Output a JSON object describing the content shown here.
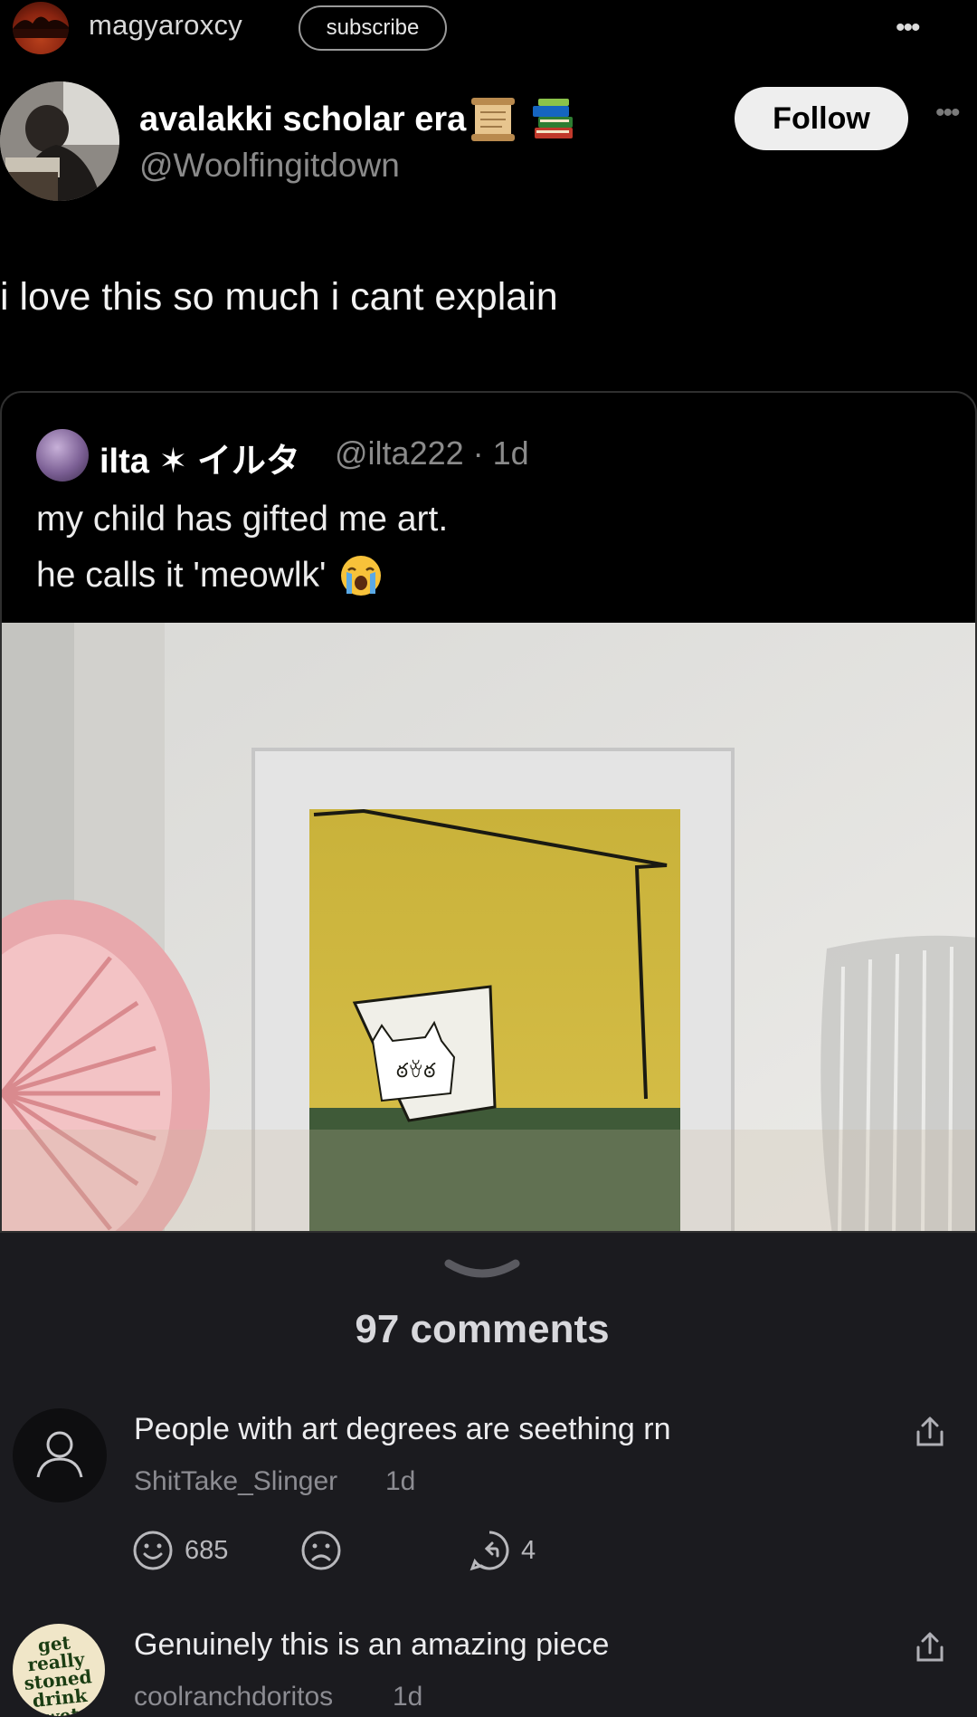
{
  "topbar": {
    "username": "magyaroxcy",
    "subscribe_label": "subscribe",
    "more_label": "•••"
  },
  "tweet": {
    "display_name": "avalakki scholar era",
    "handle": "@Woolfingitdown",
    "follow_label": "Follow",
    "more_label": "•••",
    "text": "i love this so much i cant explain"
  },
  "quote": {
    "name": "ilta ✶ イルタ",
    "meta": "@ilta222 · 1d",
    "line1": "my child has gifted me art.",
    "line2": "he calls it 'meowlk'"
  },
  "comments": {
    "count_label": "97 comments",
    "items": [
      {
        "text": "People with art degrees are seething rn",
        "user": "ShitTake_Slinger",
        "age": "1d",
        "likes": "685",
        "replies": "4"
      },
      {
        "text": "Genuinely this is an amazing piece",
        "user": "coolranchdoritos",
        "age": "1d",
        "avatar_text": "get really stoned drink wet cement"
      }
    ]
  },
  "colors": {
    "background": "#000000",
    "sheet": "#1b1b1f",
    "follow_bg": "#eeeeee",
    "muted": "#8a8a8a"
  }
}
